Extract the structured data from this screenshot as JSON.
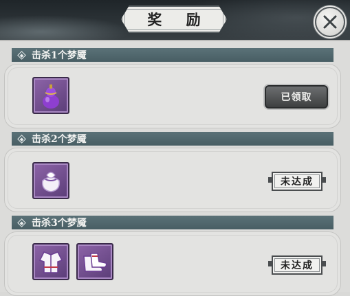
{
  "dialog": {
    "title": "奖 励"
  },
  "icons": {
    "close": "close-x-icon"
  },
  "sections": [
    {
      "title": "击杀1个梦魇",
      "rewards": [
        "purple-gourd-icon"
      ],
      "status": "已领取"
    },
    {
      "title": "击杀2个梦魇",
      "rewards": [
        "white-pouch-icon"
      ],
      "status": "未达成"
    },
    {
      "title": "击杀3个梦魇",
      "rewards": [
        "robe-outfit-icon",
        "boots-icon"
      ],
      "status": "未达成"
    }
  ],
  "colors": {
    "header_bar": "#4f666c",
    "item_frame": "#7a5496",
    "claimed_button": "#4d4f50",
    "panel_bg": "#dcdcda"
  }
}
